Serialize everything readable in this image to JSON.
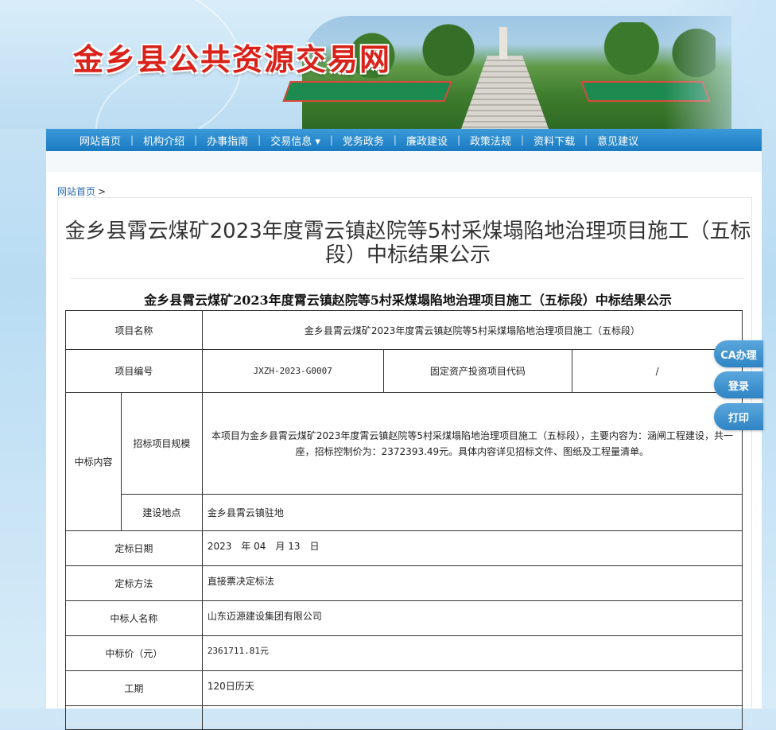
{
  "site": {
    "title": "金乡县公共资源交易网"
  },
  "nav": {
    "items": [
      {
        "label": "网站首页"
      },
      {
        "label": "机构介绍"
      },
      {
        "label": "办事指南"
      },
      {
        "label": "交易信息 ▾"
      },
      {
        "label": "党务政务"
      },
      {
        "label": "廉政建设"
      },
      {
        "label": "政策法规"
      },
      {
        "label": "资料下载"
      },
      {
        "label": "意见建议"
      }
    ]
  },
  "breadcrumb": {
    "home": "网站首页",
    "arrow": ">"
  },
  "page": {
    "title": "金乡县霄云煤矿2023年度霄云镇赵院等5村采煤塌陷地治理项目施工（五标段）中标结果公示",
    "doc_title": "金乡县霄云煤矿2023年度霄云镇赵院等5村采煤塌陷地治理项目施工（五标段）中标结果公示"
  },
  "table": {
    "project_name_label": "项目名称",
    "project_name_value": "金乡县霄云煤矿2023年度霄云镇赵院等5村采煤塌陷地治理项目施工（五标段）",
    "project_code_label": "项目编号",
    "project_code_value": "JXZH-2023-G0007",
    "fixed_asset_label": "固定资产投资项目代码",
    "fixed_asset_value": "/",
    "bid_content_label": "中标内容",
    "bid_scale_label": "招标项目规模",
    "bid_scale_value": "本项目为金乡县霄云煤矿2023年度霄云镇赵院等5村采煤塌陷地治理项目施工（五标段），主要内容为：涵闸工程建设，共一座，招标控制价为：2372393.49元。具体内容详见招标文件、图纸及工程量清单。",
    "location_label": "建设地点",
    "location_value": "金乡县霄云镇驻地",
    "date_label": "定标日期",
    "date_value": "2023　年 04　月 13　日",
    "method_label": "定标方法",
    "method_value": "直接票决定标法",
    "winner_label": "中标人名称",
    "winner_value": "山东迈源建设集团有限公司",
    "price_label": "中标价（元）",
    "price_value": "2361711.81元",
    "period_label": "工期",
    "period_value": "120日历天"
  },
  "float": {
    "ca": "CA办理",
    "login": "登录",
    "print": "打印"
  },
  "colors": {
    "title_red": "#d8221a",
    "nav_blue": "#1a7ac2",
    "float_blue": "#2f84c4"
  }
}
